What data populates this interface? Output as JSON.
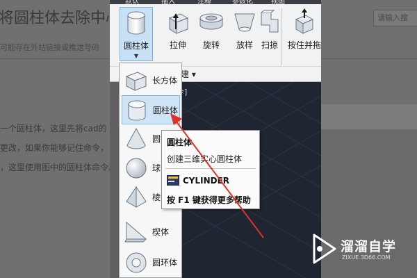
{
  "webpage": {
    "title": "将圆柱体去除中心",
    "search_placeholder": "请输入搜",
    "tip": "可能存在外站链接或推送号码",
    "paragraphs": [
      "一个圆柱体，这里先将cad的",
      "更改，如果你能够记住命令，",
      "，这里使用图中的圆柱体命令。"
    ]
  },
  "ribbon": {
    "tabs": [
      "默认",
      "插入",
      "注释",
      "参数化",
      "视图"
    ],
    "tools": [
      {
        "label": "圆柱体",
        "icon": "cylinder-icon"
      },
      {
        "label": "拉伸",
        "icon": "extrude-icon"
      },
      {
        "label": "旋转",
        "icon": "revolve-icon"
      },
      {
        "label": "放样",
        "icon": "loft-icon"
      },
      {
        "label": "扫掠",
        "icon": "sweep-icon"
      },
      {
        "label": "按住并拖",
        "icon": "presspull-icon"
      }
    ],
    "panel_label": "创建 ▾"
  },
  "canvas": {
    "label": "令]"
  },
  "dropdown": {
    "items": [
      {
        "label": "长方体",
        "icon": "box-icon"
      },
      {
        "label": "圆柱体",
        "icon": "cylinder-icon"
      },
      {
        "label": "圆锥体",
        "icon": "cone-icon"
      },
      {
        "label": "球体",
        "icon": "sphere-icon"
      },
      {
        "label": "棱锥体",
        "icon": "pyramid-icon"
      },
      {
        "label": "楔体",
        "icon": "wedge-icon"
      },
      {
        "label": "圆环体",
        "icon": "torus-icon"
      }
    ]
  },
  "tooltip": {
    "title": "圆柱体",
    "description": "创建三维实心圆柱体",
    "command": "CYLINDER",
    "help": "按 F1 键获得更多帮助"
  },
  "watermark": {
    "name": "溜溜自学",
    "url": "ZIXUE.3D66.COM"
  },
  "colors": {
    "arrow": "#e0302a",
    "canvas": "#1f2531",
    "selection": "#cfe4f7"
  }
}
